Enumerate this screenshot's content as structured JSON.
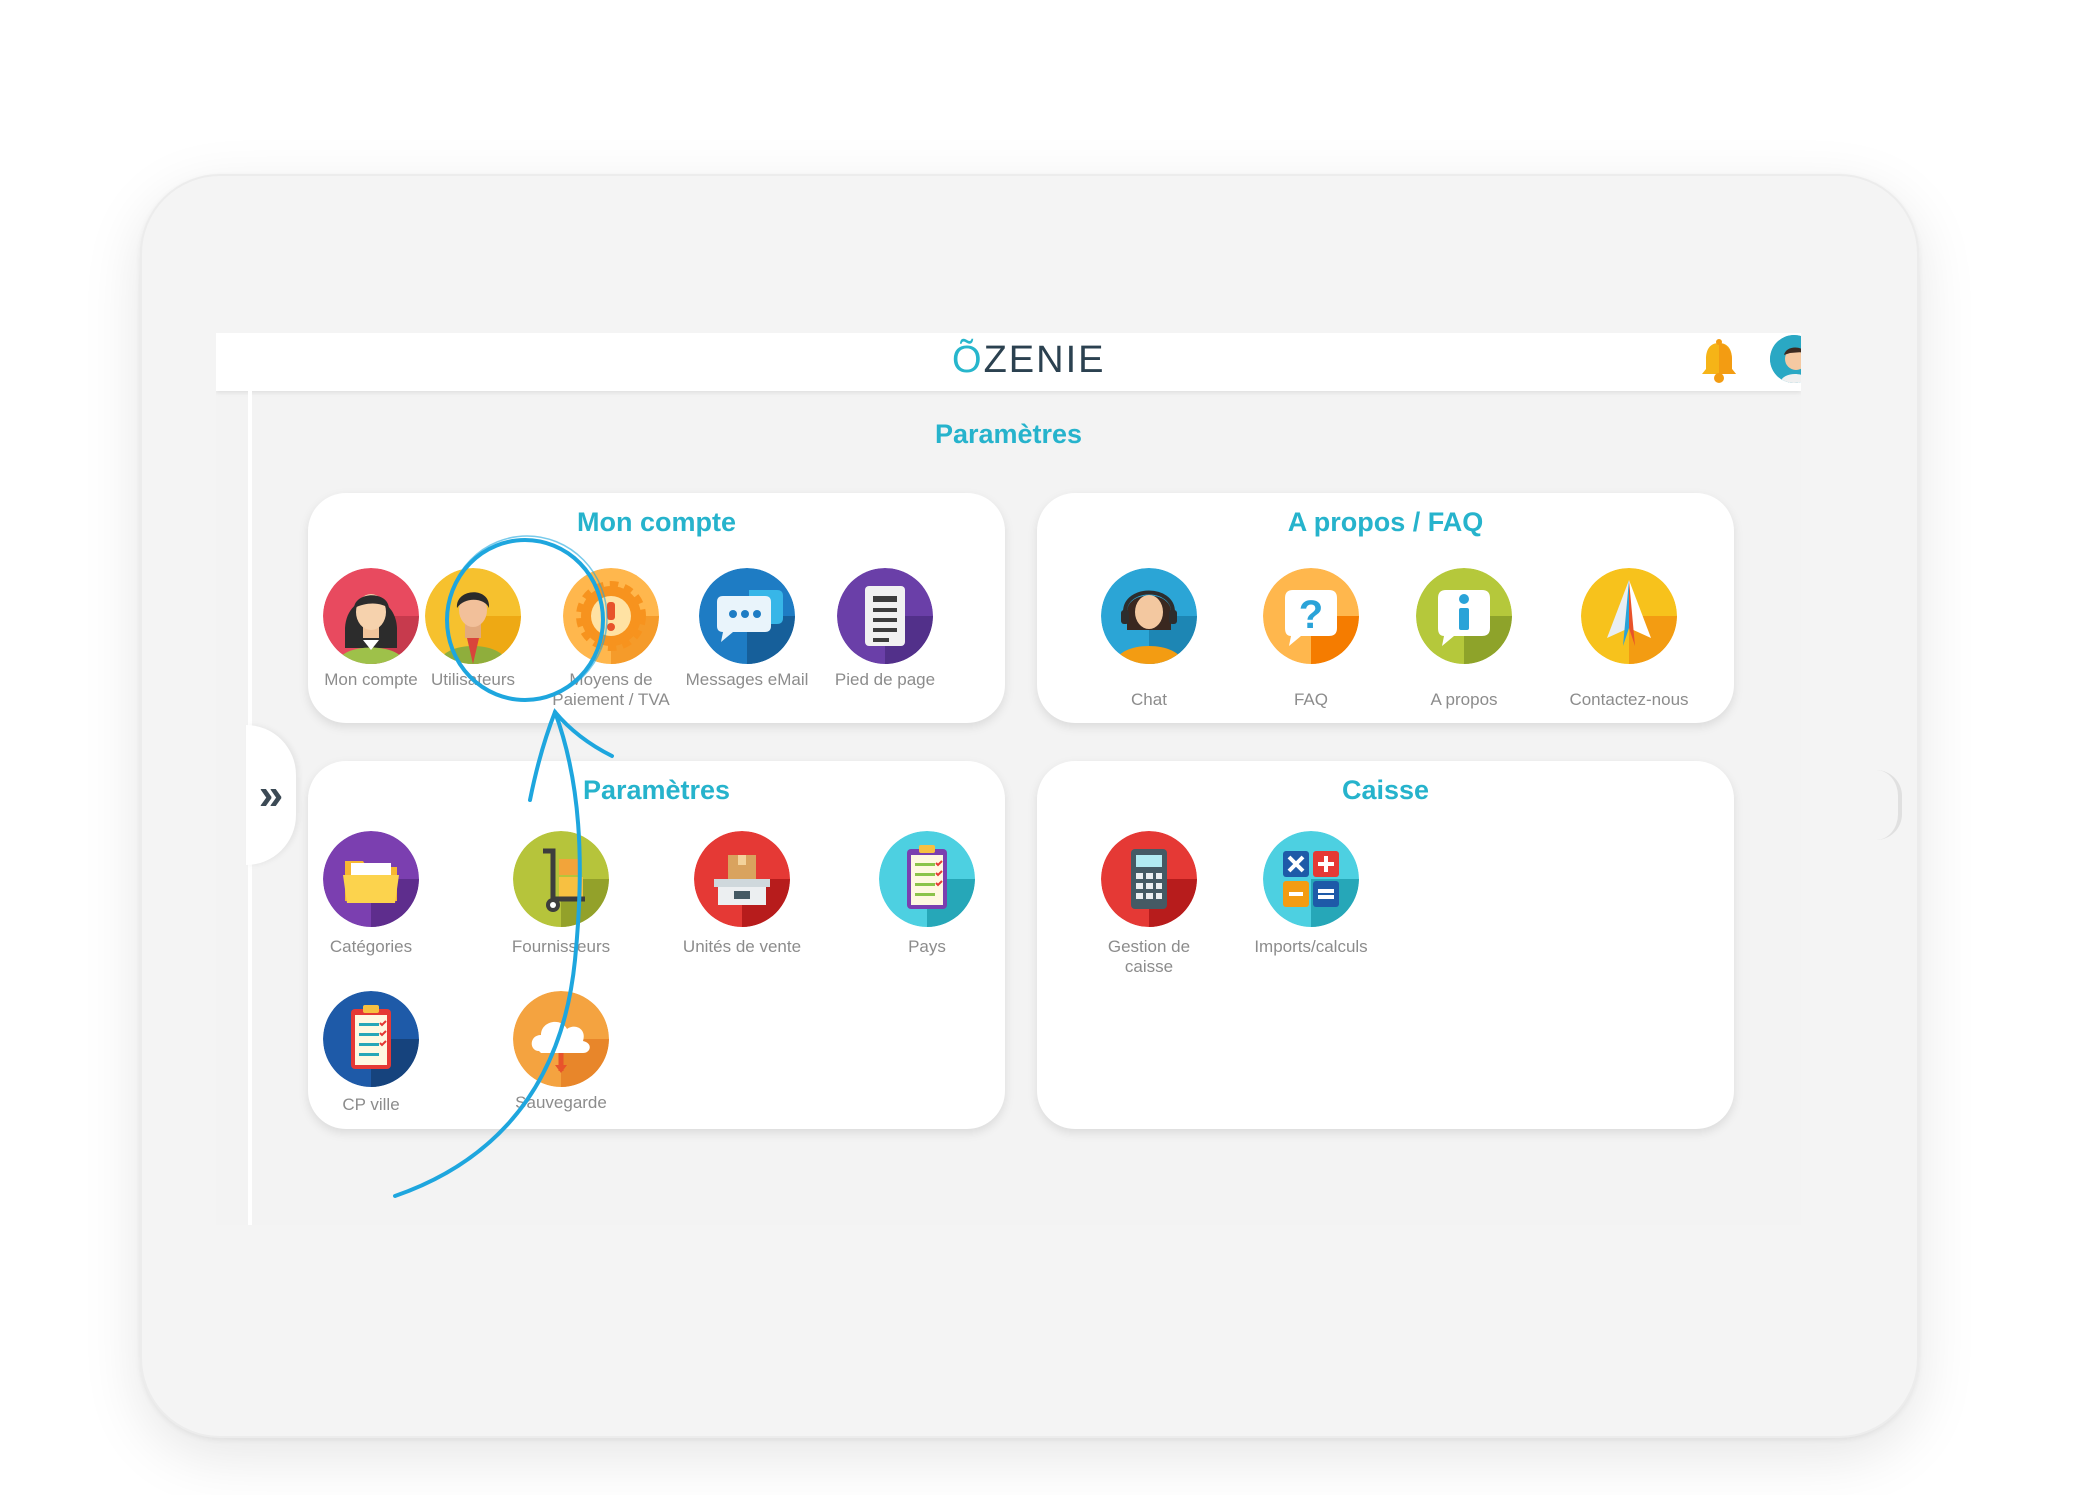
{
  "app": {
    "logo_mark": "Õ",
    "logo_text": "ZENIE"
  },
  "page": {
    "title": "Paramètres"
  },
  "sidebar": {
    "toggle_label": "»"
  },
  "cards": {
    "mon_compte": {
      "title": "Mon compte",
      "items": [
        {
          "label": "Mon compte",
          "icon": "woman-avatar-icon"
        },
        {
          "label": "Utilisateurs",
          "icon": "man-avatar-icon"
        },
        {
          "label": "Moyens de Paiement  / TVA",
          "icon": "gear-alert-icon"
        },
        {
          "label": "Messages eMail",
          "icon": "chat-bubble-icon"
        },
        {
          "label": "Pied de page",
          "icon": "document-icon"
        }
      ]
    },
    "apropos": {
      "title": "A propos / FAQ",
      "items": [
        {
          "label": "Chat",
          "icon": "support-agent-icon"
        },
        {
          "label": "FAQ",
          "icon": "question-icon"
        },
        {
          "label": "A propos",
          "icon": "info-icon"
        },
        {
          "label": "Contactez-nous",
          "icon": "paper-plane-icon"
        }
      ]
    },
    "parametres": {
      "title": "Paramètres",
      "items": [
        {
          "label": "Catégories",
          "icon": "folder-icon"
        },
        {
          "label": "Fournisseurs",
          "icon": "hand-truck-icon"
        },
        {
          "label": "Unités de vente",
          "icon": "scale-box-icon"
        },
        {
          "label": "Pays",
          "icon": "clipboard-icon"
        },
        {
          "label": "CP ville",
          "icon": "checklist-icon"
        },
        {
          "label": "Sauvegarde",
          "icon": "cloud-upload-icon"
        }
      ]
    },
    "caisse": {
      "title": "Caisse",
      "items": [
        {
          "label": "Gestion de caisse",
          "icon": "calculator-icon"
        },
        {
          "label": "Imports/calculs",
          "icon": "math-operators-icon"
        }
      ]
    }
  },
  "colors": {
    "accent": "#26b3cc",
    "annotation": "#1ea6de"
  }
}
